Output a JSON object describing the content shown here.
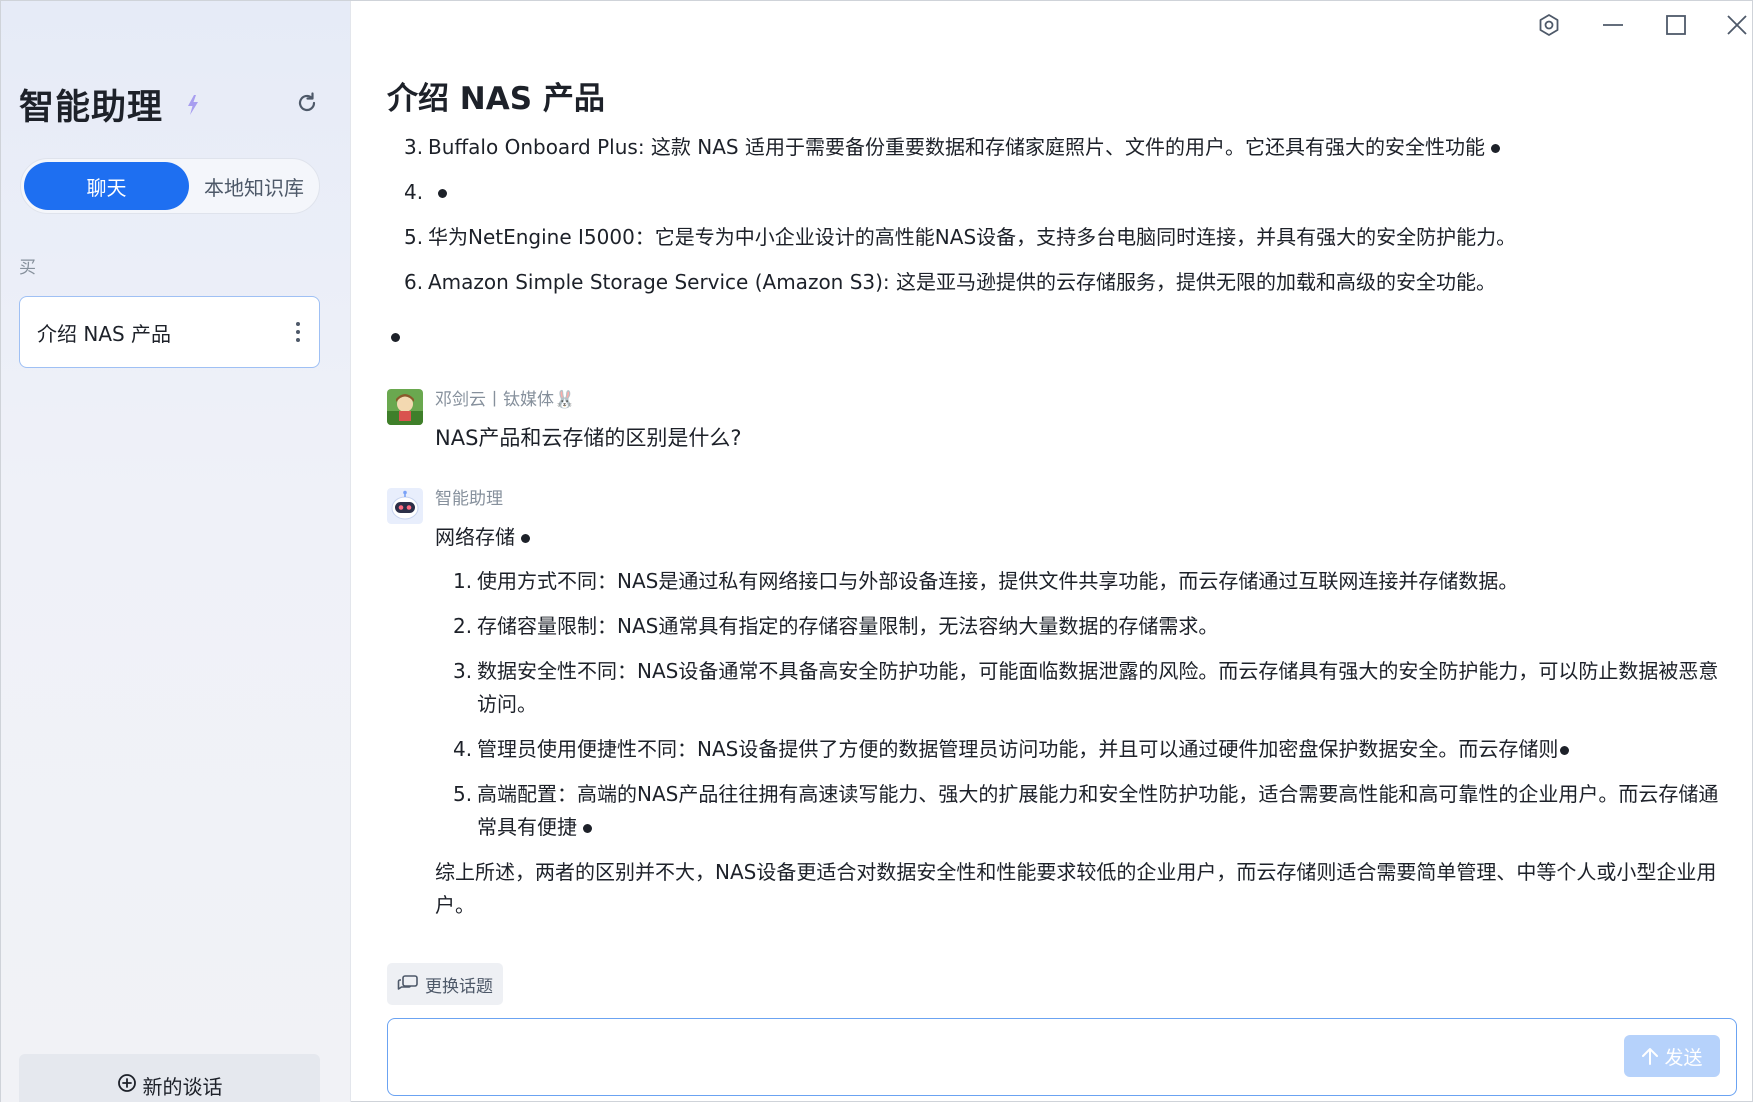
{
  "sidebar": {
    "title": "智能助理",
    "tabs": [
      {
        "label": "聊天",
        "active": true
      },
      {
        "label": "本地知识库",
        "active": false
      }
    ],
    "group_label": "买",
    "conversations": [
      {
        "title": "介绍 NAS 产品"
      }
    ],
    "new_chat_label": "新的谈话"
  },
  "window_controls": [
    "settings-icon",
    "minimize-icon",
    "maximize-icon",
    "close-icon"
  ],
  "chat": {
    "title": "介绍 NAS 产品",
    "previous_list": [
      {
        "num": "3.",
        "text": "Buffalo Onboard Plus: 这款 NAS 适用于需要备份重要数据和存储家庭照片、文件的用户。它还具有强大的安全性功能"
      },
      {
        "num": "4.",
        "text": ""
      },
      {
        "num": "5.",
        "text": "华为NetEngine I5000：它是专为中小企业设计的高性能NAS设备，支持多台电脑同时连接，并具有强大的安全防护能力。"
      },
      {
        "num": "6.",
        "text": "Amazon Simple Storage Service (Amazon S3): 这是亚马逊提供的云存储服务，提供无限的加载和高级的安全功能。"
      }
    ],
    "user_message": {
      "author": "邓剑云丨钛媒体🐰",
      "text": "NAS产品和云存储的区别是什么?"
    },
    "bot_message": {
      "author": "智能助理",
      "intro": "网络存储",
      "list": [
        {
          "num": "1.",
          "text": "使用方式不同：NAS是通过私有网络接口与外部设备连接，提供文件共享功能，而云存储通过互联网连接并存储数据。"
        },
        {
          "num": "2.",
          "text": "存储容量限制：NAS通常具有指定的存储容量限制，无法容纳大量数据的存储需求。"
        },
        {
          "num": "3.",
          "text": "数据安全性不同：NAS设备通常不具备高安全防护功能，可能面临数据泄露的风险。而云存储具有强大的安全防护能力，可以防止数据被恶意访问。"
        },
        {
          "num": "4.",
          "text": "管理员使用便捷性不同：NAS设备提供了方便的数据管理员访问功能，并且可以通过硬件加密盘保护数据安全。而云存储则"
        },
        {
          "num": "5.",
          "text": "高端配置：高端的NAS产品往往拥有高速读写能力、强大的扩展能力和安全性防护功能，适合需要高性能和高可靠性的企业用户。而云存储通常具有便捷"
        }
      ],
      "summary": "综上所述，两者的区别并不大，NAS设备更适合对数据安全性和性能要求较低的企业用户，而云存储则适合需要简单管理、中等个人或小型企业用户。"
    },
    "change_topic_label": "更换话题",
    "input": {
      "value": "",
      "placeholder": ""
    },
    "send_label": "发送"
  },
  "colors": {
    "accent": "#1e6ff1",
    "send_disabled": "#b6d2fb",
    "input_border": "#6ba3f2"
  }
}
